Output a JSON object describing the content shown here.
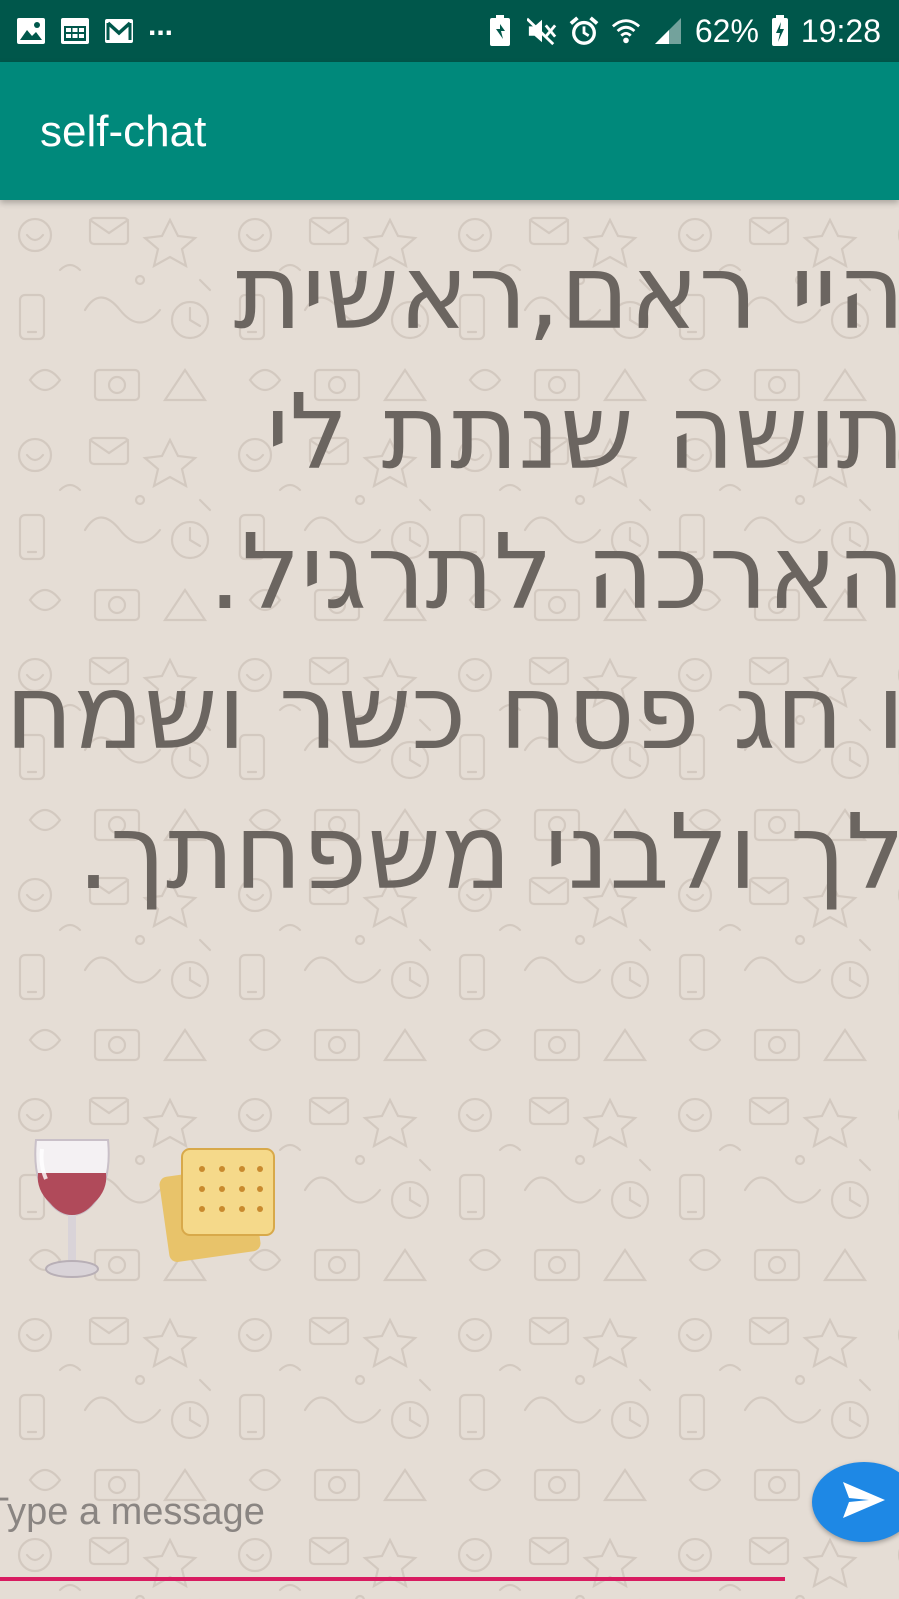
{
  "status_bar": {
    "battery": "62%",
    "time": "19:28",
    "more": "...",
    "icons_left": [
      "image-icon",
      "calendar-icon",
      "gmail-icon"
    ],
    "icons_right": [
      "battery-saver-icon",
      "mute-icon",
      "alarm-icon",
      "wifi-icon",
      "signal-icon",
      "battery-charging-icon"
    ]
  },
  "app_bar": {
    "title": "self-chat"
  },
  "message": {
    "text": "היי ראם,ראשית תושה שנתת לי הארכה לתרגיל.\nו חג פסח כשר ושמח לך ולבני משפחתך.",
    "emojis": [
      "wine-glass",
      "matzah-crackers"
    ]
  },
  "composer": {
    "placeholder": "Type a message"
  },
  "colors": {
    "status_bar": "#00574b",
    "app_bar": "#00897b",
    "chat_background": "#e5ddd5",
    "message_text": "#6b6560",
    "input_underline": "#d81b60",
    "send_button": "#1e88e5"
  }
}
